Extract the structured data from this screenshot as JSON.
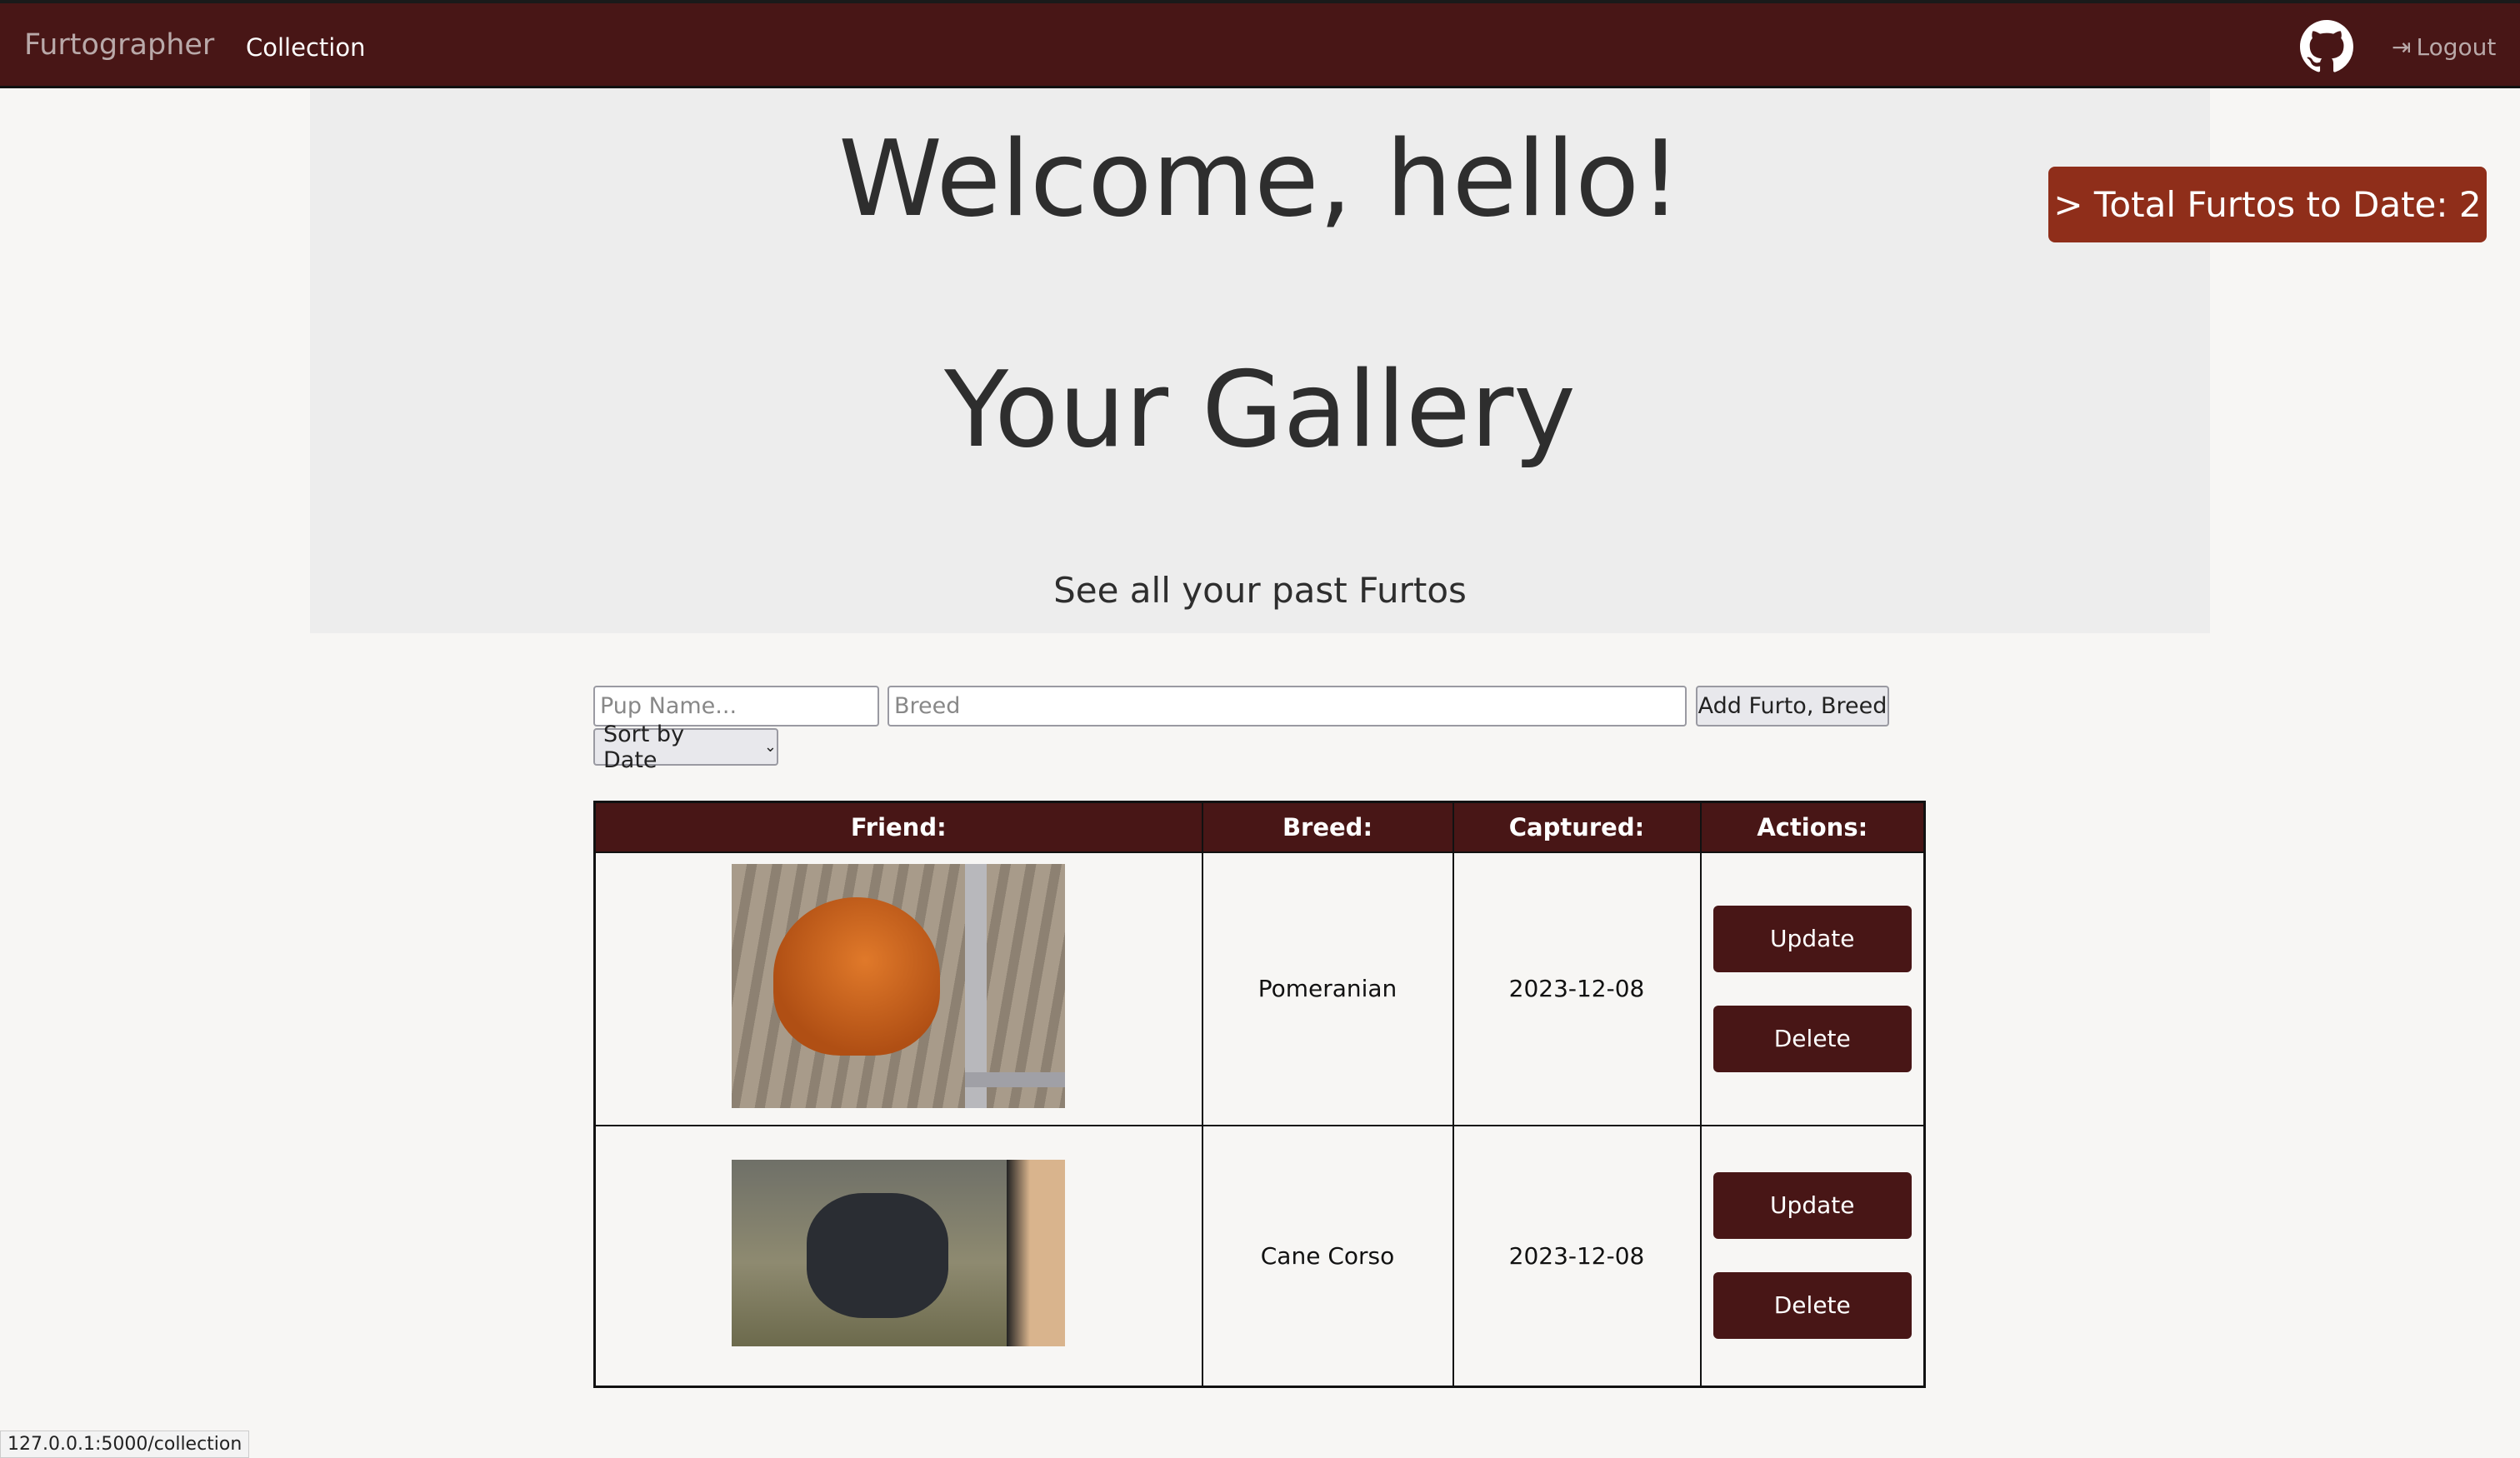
{
  "nav": {
    "brand": "Furtographer",
    "links": [
      "Collection"
    ],
    "github_icon": "github-icon",
    "logout": "Logout"
  },
  "jumbotron": {
    "welcome": "Welcome, hello!",
    "gallery_title": "Your Gallery",
    "subtitle": "See all your past Furtos"
  },
  "total_button": "> Total Furtos to Date: 2",
  "form": {
    "name_placeholder": "Pup Name...",
    "breed_placeholder": "Breed",
    "add_button": "Add Furto, Breed",
    "sort_selected": "Sort by Date"
  },
  "table": {
    "headers": [
      "Friend:",
      "Breed:",
      "Captured:",
      "Actions:"
    ],
    "rows": [
      {
        "breed": "Pomeranian",
        "captured": "2023-12-08",
        "update": "Update",
        "delete": "Delete"
      },
      {
        "breed": "Cane Corso",
        "captured": "2023-12-08",
        "update": "Update",
        "delete": "Delete"
      }
    ]
  },
  "status_url": "127.0.0.1:5000/collection",
  "colors": {
    "nav": "#481616",
    "accent": "#8f2e1a"
  }
}
